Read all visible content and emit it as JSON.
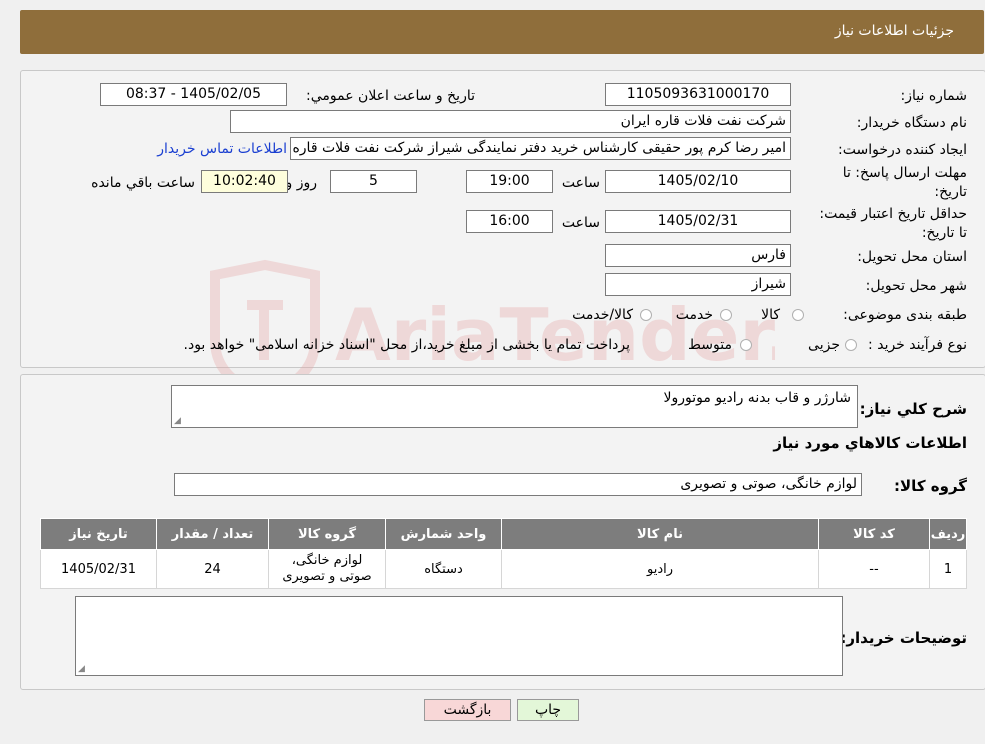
{
  "page_title": "جزئیات اطلاعات نیاز",
  "labels": {
    "need_number": "شماره نیاز:",
    "announce_datetime": "تاریخ و ساعت اعلان عمومي:",
    "buyer_org": "نام دستگاه خریدار:",
    "requester": "ایجاد کننده درخواست:",
    "reply_deadline": "مهلت ارسال پاسخ: تا تاریخ:",
    "hour": "ساعت",
    "day_and": "روز و",
    "remaining": "ساعت باقي مانده",
    "price_validity": "حداقل تاریخ اعتبار قیمت: تا تاریخ:",
    "province": "استان محل تحویل:",
    "city": "شهر محل تحویل:",
    "category": "طبقه بندی موضوعی:",
    "process_type": "نوع فرآیند خرید :",
    "need_desc": "شرح کلي نیاز:",
    "goods_info": "اطلاعات کالاهاي مورد نیاز",
    "goods_group": "گروه کالا:",
    "buyer_notes": "توضیحات خریدار:"
  },
  "values": {
    "need_number": "1105093631000170",
    "announce_datetime": "1405/02/05 - 08:37",
    "buyer_org": "شرکت نفت فلات قاره ایران",
    "requester": "امیر رضا کرم پور حقیقی کارشناس خرید دفتر نمایندگی شیراز شرکت نفت فلات قاره ایران",
    "contact_link": "اطلاعات تماس خریدار",
    "reply_date": "1405/02/10",
    "reply_time": "19:00",
    "days": "5",
    "remaining_time": "10:02:40",
    "validity_date": "1405/02/31",
    "validity_time": "16:00",
    "province": "فارس",
    "city": "شیراز",
    "need_desc": "شارژر و قاب بدنه رادیو موتورولا",
    "goods_group": "لوازم خانگی، صوتی و تصویری",
    "buyer_notes": ""
  },
  "category_options": [
    "کالا",
    "خدمت",
    "کالا/خدمت"
  ],
  "process_options": [
    "جزیی",
    "متوسط"
  ],
  "process_note": "پرداخت تمام یا بخشی از مبلغ خرید،از محل \"اسناد خزانه اسلامی\" خواهد بود.",
  "table": {
    "headers": [
      "ردیف",
      "کد کالا",
      "نام کالا",
      "واحد شمارش",
      "گروه کالا",
      "تعداد / مقدار",
      "تاریخ نیاز"
    ],
    "rows": [
      [
        "1",
        "--",
        "رادیو",
        "دستگاه",
        "لوازم خانگی، صوتی و تصویری",
        "24",
        "1405/02/31"
      ]
    ]
  },
  "buttons": {
    "print": "چاپ",
    "back": "بازگشت"
  },
  "watermark": "AriaTender.neT",
  "colors": {
    "header": "#8f6e3b",
    "table_header": "#7d7d7d",
    "link": "#1a3fd1",
    "back_button": "#f8d7d7",
    "print_button": "#e3f7d8",
    "remaining_box": "#fefedc"
  }
}
